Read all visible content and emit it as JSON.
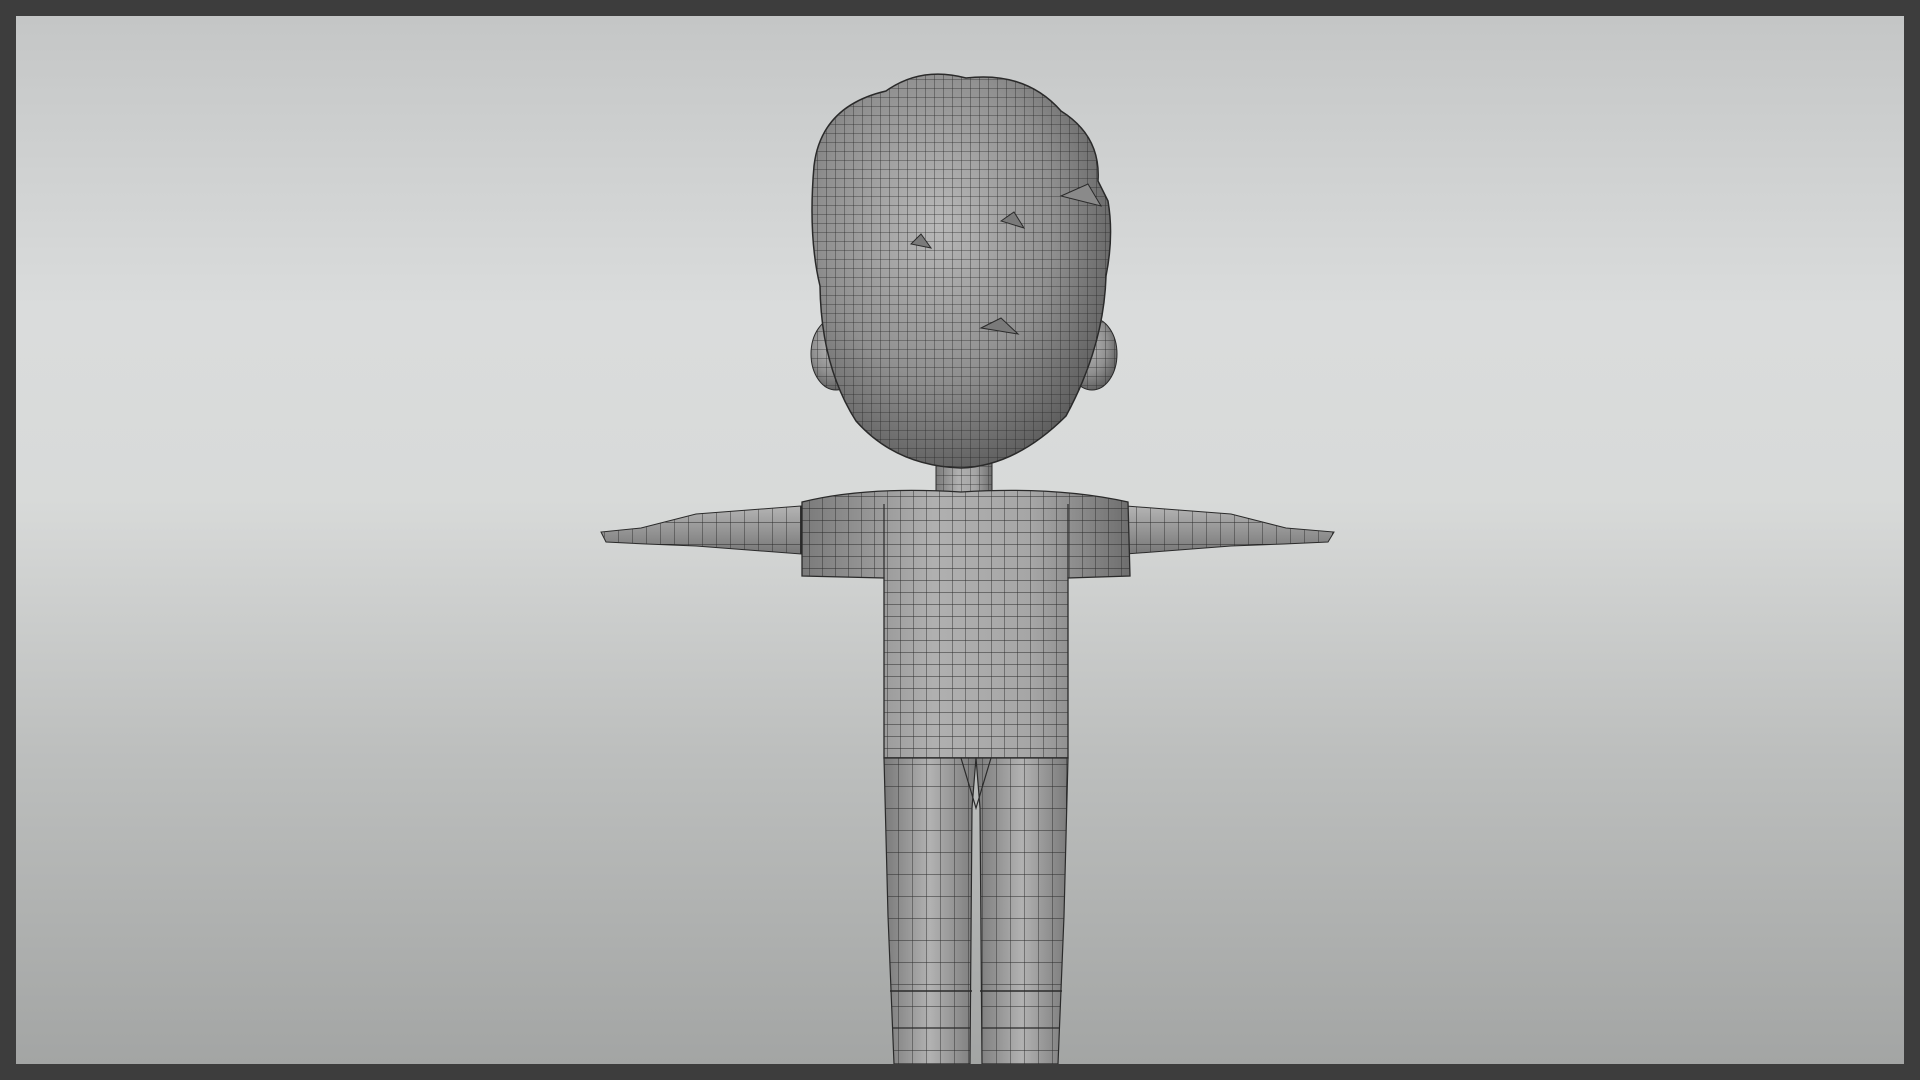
{
  "viewport": {
    "background_top": "#c4c6c6",
    "background_mid": "#dadcdc",
    "background_bottom": "#a3a5a4",
    "frame_color": "#3d3d3d"
  },
  "model": {
    "shading": "wireframe-on-shaded",
    "pose": "T-pose",
    "view": "front",
    "mesh_fill": "#9a9a9a",
    "wire_color": "#1e1e1e"
  }
}
